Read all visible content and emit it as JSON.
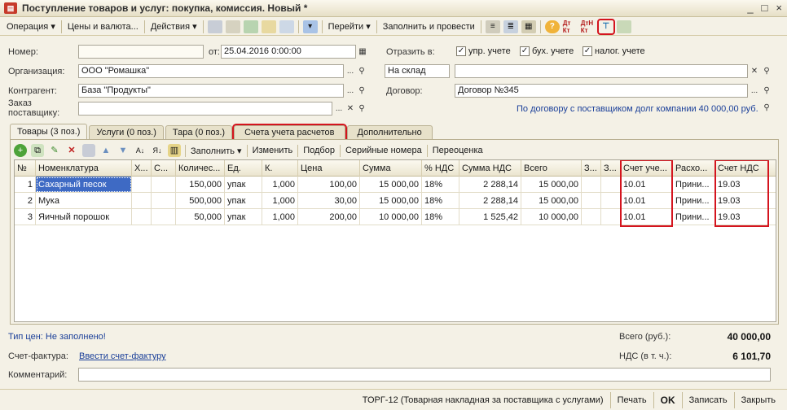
{
  "window": {
    "title": "Поступление товаров и услуг: покупка, комиссия. Новый *",
    "controls": [
      "_",
      "□",
      "×"
    ]
  },
  "toolbar": {
    "operation": "Операция ▾",
    "prices": "Цены и валюта...",
    "actions": "Действия ▾",
    "goto": "Перейти ▾",
    "fill_post": "Заполнить и провести"
  },
  "form": {
    "number_label": "Номер:",
    "number_value": "",
    "from_label": "от:",
    "date_value": "25.04.2016  0:00:00",
    "org_label": "Организация:",
    "org_value": "ООО \"Ромашка\"",
    "contr_label": "Контрагент:",
    "contr_value": "База \"Продукты\"",
    "order_label": "Заказ\nпоставщику:",
    "order_value": "",
    "reflect_label": "Отразить в:",
    "chk_mgmt": "упр. учете",
    "chk_acc": "бух. учете",
    "chk_tax": "налог. учете",
    "warehouse_type": "На склад",
    "warehouse_value": "",
    "contract_label": "Договор:",
    "contract_value": "Договор №345",
    "debt_note": "По договору с поставщиком долг компании 40 000,00 руб."
  },
  "tabs": [
    {
      "label": "Товары (3 поз.)"
    },
    {
      "label": "Услуги (0 поз.)"
    },
    {
      "label": "Тара (0 поз.)"
    },
    {
      "label": "Счета учета расчетов"
    },
    {
      "label": "Дополнительно"
    }
  ],
  "table_toolbar": {
    "fill": "Заполнить ▾",
    "edit": "Изменить",
    "select": "Подбор",
    "serial": "Серийные номера",
    "revalue": "Переоценка"
  },
  "table": {
    "headers": [
      "№",
      "Номенклатура",
      "Х...",
      "С...",
      "Количес...",
      "Ед.",
      "К.",
      "Цена",
      "Сумма",
      "% НДС",
      "Сумма НДС",
      "Всего",
      "З...",
      "З...",
      "Счет уче...",
      "Расхо...",
      "Счет НДС"
    ],
    "rows": [
      {
        "n": "1",
        "name": "Сахарный песок",
        "qty": "150,000",
        "unit": "упак",
        "k": "1,000",
        "price": "100,00",
        "sum": "15 000,00",
        "vat": "18%",
        "vat_sum": "2 288,14",
        "total": "15 000,00",
        "acc": "10.01",
        "exp": "Прини...",
        "vat_acc": "19.03"
      },
      {
        "n": "2",
        "name": "Мука",
        "qty": "500,000",
        "unit": "упак",
        "k": "1,000",
        "price": "30,00",
        "sum": "15 000,00",
        "vat": "18%",
        "vat_sum": "2 288,14",
        "total": "15 000,00",
        "acc": "10.01",
        "exp": "Прини...",
        "vat_acc": "19.03"
      },
      {
        "n": "3",
        "name": "Яичный порошок",
        "qty": "50,000",
        "unit": "упак",
        "k": "1,000",
        "price": "200,00",
        "sum": "10 000,00",
        "vat": "18%",
        "vat_sum": "1 525,42",
        "total": "10 000,00",
        "acc": "10.01",
        "exp": "Прини...",
        "vat_acc": "19.03"
      }
    ]
  },
  "footer": {
    "price_type": "Тип цен: Не заполнено!",
    "total_label": "Всего (руб.):",
    "total_value": "40 000,00",
    "invoice_label": "Счет-фактура:",
    "invoice_link": "Ввести счет-фактуру",
    "vat_label": "НДС (в т. ч.):",
    "vat_value": "6 101,70",
    "comment_label": "Комментарий:",
    "comment_value": ""
  },
  "statusbar": {
    "torg": "ТОРГ-12 (Товарная накладная за поставщика с услугами)",
    "print": "Печать",
    "ok": "OK",
    "save": "Записать",
    "close": "Закрыть"
  }
}
